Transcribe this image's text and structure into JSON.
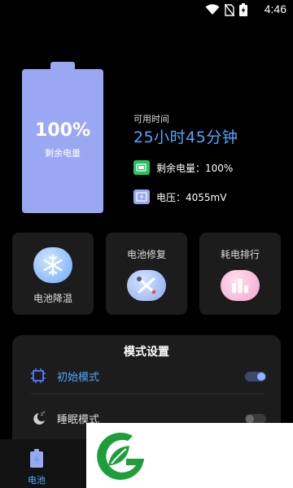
{
  "status_bar": {
    "time": "4:46",
    "icons": [
      "wifi-icon",
      "no-sim-icon",
      "charging-battery-icon"
    ]
  },
  "battery": {
    "percent": "100%",
    "label": "剩余电量",
    "level_fraction": 1.0,
    "color": "#9aa8f4"
  },
  "info": {
    "available_label": "可用时间",
    "available_value": "25小时45分钟",
    "remaining_text": "剩余电量：100%",
    "voltage_text": "电压：4055mV"
  },
  "cards": [
    {
      "label": "电池降温",
      "icon": "snowflake-icon"
    },
    {
      "label": "电池修复",
      "icon": "wrench-screwdriver-icon"
    },
    {
      "label": "耗电排行",
      "icon": "bar-chart-icon"
    }
  ],
  "mode_settings": {
    "title": "模式设置",
    "modes": [
      {
        "label": "初始模式",
        "icon": "chip-icon",
        "enabled": true
      },
      {
        "label": "睡眠模式",
        "icon": "sleep-moon-icon",
        "enabled": false
      }
    ]
  },
  "bottom_nav": {
    "battery_tab_label": "电池"
  },
  "colors": {
    "accent": "#4fa9ff",
    "background": "#000000",
    "card": "#1c1c1c",
    "remaining_icon": "#22c55e",
    "logo_green": "#1e9e3a"
  }
}
